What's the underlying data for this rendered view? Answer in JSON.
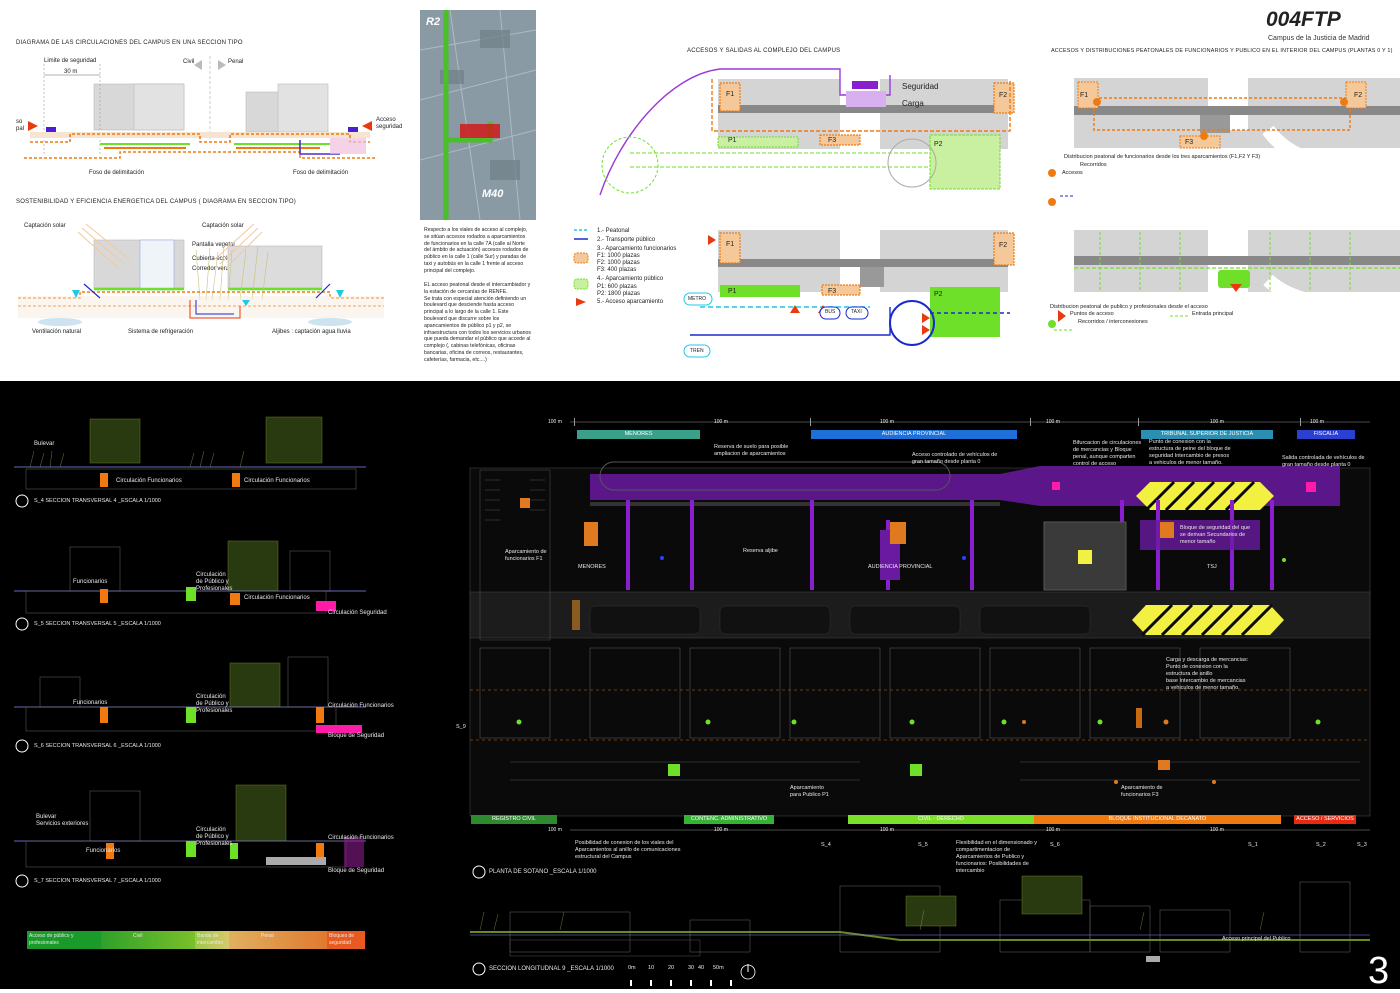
{
  "title": "004FTP",
  "subtitle": "Campus de la Justicia de Madrid",
  "page_number": "3",
  "top_left": {
    "circ_title": "DIAGRAMA DE LAS CIRCULACIONES DEL CAMPUS EN UNA SECCION TIPO",
    "limite": "Limite de seguridad",
    "dist": "30 m",
    "civil": "Civil",
    "penal": "Penal",
    "so_pal": "so\npal",
    "acceso_seg": "Acceso\nseguridad",
    "foso1": "Foso de delimitación",
    "foso2": "Foso de delimitación",
    "sost_title": "SOSTENIBILIDAD Y EFICIENCIA ENERGETICA DEL CAMPUS ( DIAGRAMA EN SECCION TIPO)",
    "captacion1": "Captación solar",
    "captacion2": "Captación solar",
    "pantalla": "Pantalla vegetal",
    "cubierta": "Cubierta ecológica",
    "corredor": "Corredor verde",
    "ventilacion": "Ventilación natural",
    "refrigeracion": "Sistema de refrigeración",
    "aljibes": "Aljibes : captación agua lluvia"
  },
  "aerial": {
    "r2": "R2",
    "m40": "M40",
    "para1": "Respecto a los viales de acceso al complejo,\nse sitúan accesos rodados a aparcamientos\nde funcionarios en la  calle 7A  (calle al Norte\ndel ámbito de actuación)   accesos rodados de\npúblico en la calle 1 (calle Sur) y paradas de\ntaxi y autobús en la calle 1 frente al acceso\nprincipal del complejo.",
    "para2": "EL acceso peatonal desde el intercambiador y\nla estación de cercanías de RENFE.\nSe trata con especial atención  definiendo un\nboulevard que desciende hasta  acceso\nprincipal a lo largo de la calle 1.  Este\nboulevard que discurre sobre los\napancamientos de público  p1 y  p2, se\ninfraestructura con todos los servicios urbanos\nque pueda demandar el público que accede al\ncomplejo (, cabinas telefónicas, oficinas\nbancarias, oficina de correos, restaurantes,\ncafeterías,  farmacia, etc....)"
  },
  "accesos": {
    "title": "ACCESOS Y SALIDAS AL COMPLEJO DEL CAMPUS",
    "seguridad": "Seguridad",
    "carga": "Carga",
    "f1": "F1",
    "f2": "F2",
    "f3": "F3",
    "p1": "P1",
    "p2": "P2",
    "metro": "METRO",
    "tren": "TREN",
    "bus": "BUS",
    "taxi": "TAXI"
  },
  "legend": {
    "l1": "1.- Peatonal",
    "l2": "2.- Transporte público",
    "l3": "3.- Aparcamiento funcionarios",
    "l3a": "F1: 1000 plazas",
    "l3b": "F2: 1000 plazas",
    "l3c": "F3:   400 plazas",
    "l4": "4.- Aparcamiento público",
    "l4a": "P1:   600 plazas",
    "l4b": "P2: 1800 plazas",
    "l5": "5.- Acceso aparcamiento"
  },
  "peatonal": {
    "title": "ACCESOS Y DISTRIBUCIONES PEATONALES DE FUNCIONARIOS Y PUBLICO EN EL INTERIOR DEL CAMPUS (PLANTAS 0 Y 1)",
    "dist_func": "Distribucion peatonal de funcionarios desde los tres aparcamientos (F1,F2 Y F3)",
    "recorridos": "Recorridos",
    "accesos": "Accesos",
    "dist_pub": "Distribucion peatonal de publico y profesionales desde el acceso",
    "puntos": "Puntos de acceso",
    "entrada": "Entrada principal",
    "recorridos_int": "Recorridos / interconexiones"
  },
  "sections": {
    "bulevar": "Bulevar",
    "circ_func": "Circulación Funcionarios",
    "s4": "S_4   SECCION TRANSVERSAL 4     _ESCALA  1/1000",
    "funcionarios": "Funcionarios",
    "circ_pub": "Circulación\nde Público y\nProfesionales",
    "circ_seg": "Circulación Seguridad",
    "s5": "S_5   SECCION TRANSVERSAL 5     _ESCALA  1/1000",
    "bloque_seg": "Bloque de Seguridad",
    "s6": "S_6   SECCION TRANSVERSAL 6     _ESCALA  1/1000",
    "bulevar_serv": "Bulevar\nServicios exteriores",
    "s7": "S_7   SECCION TRANSVERSAL 7     _ESCALA  1/1000",
    "scale": [
      {
        "label": "Acceso de público y\nprofesionales",
        "color": "#1a9a2a"
      },
      {
        "label": "Civil",
        "color": "#6ab82a"
      },
      {
        "label": "Banda de\nintercambio",
        "color": "#c7cf5a"
      },
      {
        "label": "Penal",
        "color": "#e2a050"
      },
      {
        "label": "Bloques de\nseguridad",
        "color": "#e85a20"
      }
    ]
  },
  "plan": {
    "top_bars": [
      {
        "label": "MENORES",
        "color": "#3aa08a"
      },
      {
        "label": "AUDIENCIA PROVINCIAL",
        "color": "#1e6fd8"
      },
      {
        "label": "TRIBUNAL SUPERIOR DE JUSTICIA",
        "color": "#2a8fb0"
      },
      {
        "label": "FISCALIA",
        "color": "#2a40d0"
      }
    ],
    "bottom_bars": [
      {
        "label": "REGISTRO CIVIL",
        "color": "#2f8a2f"
      },
      {
        "label": "CONTENC. ADMINISTRATIVO",
        "color": "#36b336"
      },
      {
        "label": "CIVIL - DERECHO",
        "color": "#7be02a"
      },
      {
        "label": "BLOQUE INSTITUCIONAL DECANATO",
        "color": "#f07a10"
      },
      {
        "label": "ACCESO / SERVICIOS",
        "color": "#e82a10"
      }
    ],
    "m100": "100 m",
    "reserva_suelo": "Reserva de suelo para posible\nampliacion de aparcamientos",
    "acceso_ctrl": "Acceso controlado de vehículos de\ngran tamaño desde planta 0",
    "bifurcacion": "Bifurcacion de circulaciones\nde mercancias y Bloque\npenal, aunque comparten\ncontrol de acceso",
    "punto_conexion": "Punto de conexion con la\nestructura de peine del bloque de\nseguridad Intercambio de presos\na vehiculos de menor tamaño.",
    "salida_ctrl": "Salida controlada de vehículos de\ngran tamaño desde planta 0",
    "aparc_f1": "Aparcamiento de\nfuncionarios F1",
    "menores": "MENORES",
    "reserva_aljibe": "Reserva aljibe",
    "audiencia": "AUDIENCIA PROVINCIAL",
    "bloque_seg": "Bloque de seguridad del que\nse derivan Secundarios de\nmenor tamaño",
    "tsj": "TSJ",
    "carga_desc": "Carga y descarga de mercancias:\nPunto de conexion con la\nestructura de anillo\nbase Intercambio de mercancias\na vehiculos de menor tamaño.",
    "aparc_p1": "Aparcamiento\npara Publico P1",
    "aparc_f3": "Aparcamiento de\nfuncionarios F3",
    "s9": "S_9",
    "s_labels": [
      "S_4",
      "S_5",
      "S_6",
      "S_1",
      "S_2",
      "S_3"
    ],
    "posibilidad": "Posibilidad de conexion de los viales del\nAparcamientos al anillo de comunicaciones\nestructural del Campus",
    "flexibilidad": "Flexibilidad en el dimensionado y\ncompartimentacion de\nAparcamientos de Publico y\nfuncionarios: Posibilidades de\nintercambio",
    "planta": "PLANTA DE SOTANO  _ESCALA  1/1000",
    "long": "SECCION LONGITUDNAL 9   _ESCALA  1/1000",
    "acceso_pub": "Acceso principal del Publico",
    "scalebar": [
      "0m",
      "10",
      "20",
      "30",
      "40",
      "50m"
    ]
  },
  "colors": {
    "orange": "#f07a10",
    "green": "#6fe02a",
    "purple": "#8a1fd0",
    "magenta": "#ff1aa8",
    "blue": "#1a2ad0",
    "cyan": "#20c8e8",
    "red": "#e83a10",
    "yellow": "#f2f040"
  }
}
